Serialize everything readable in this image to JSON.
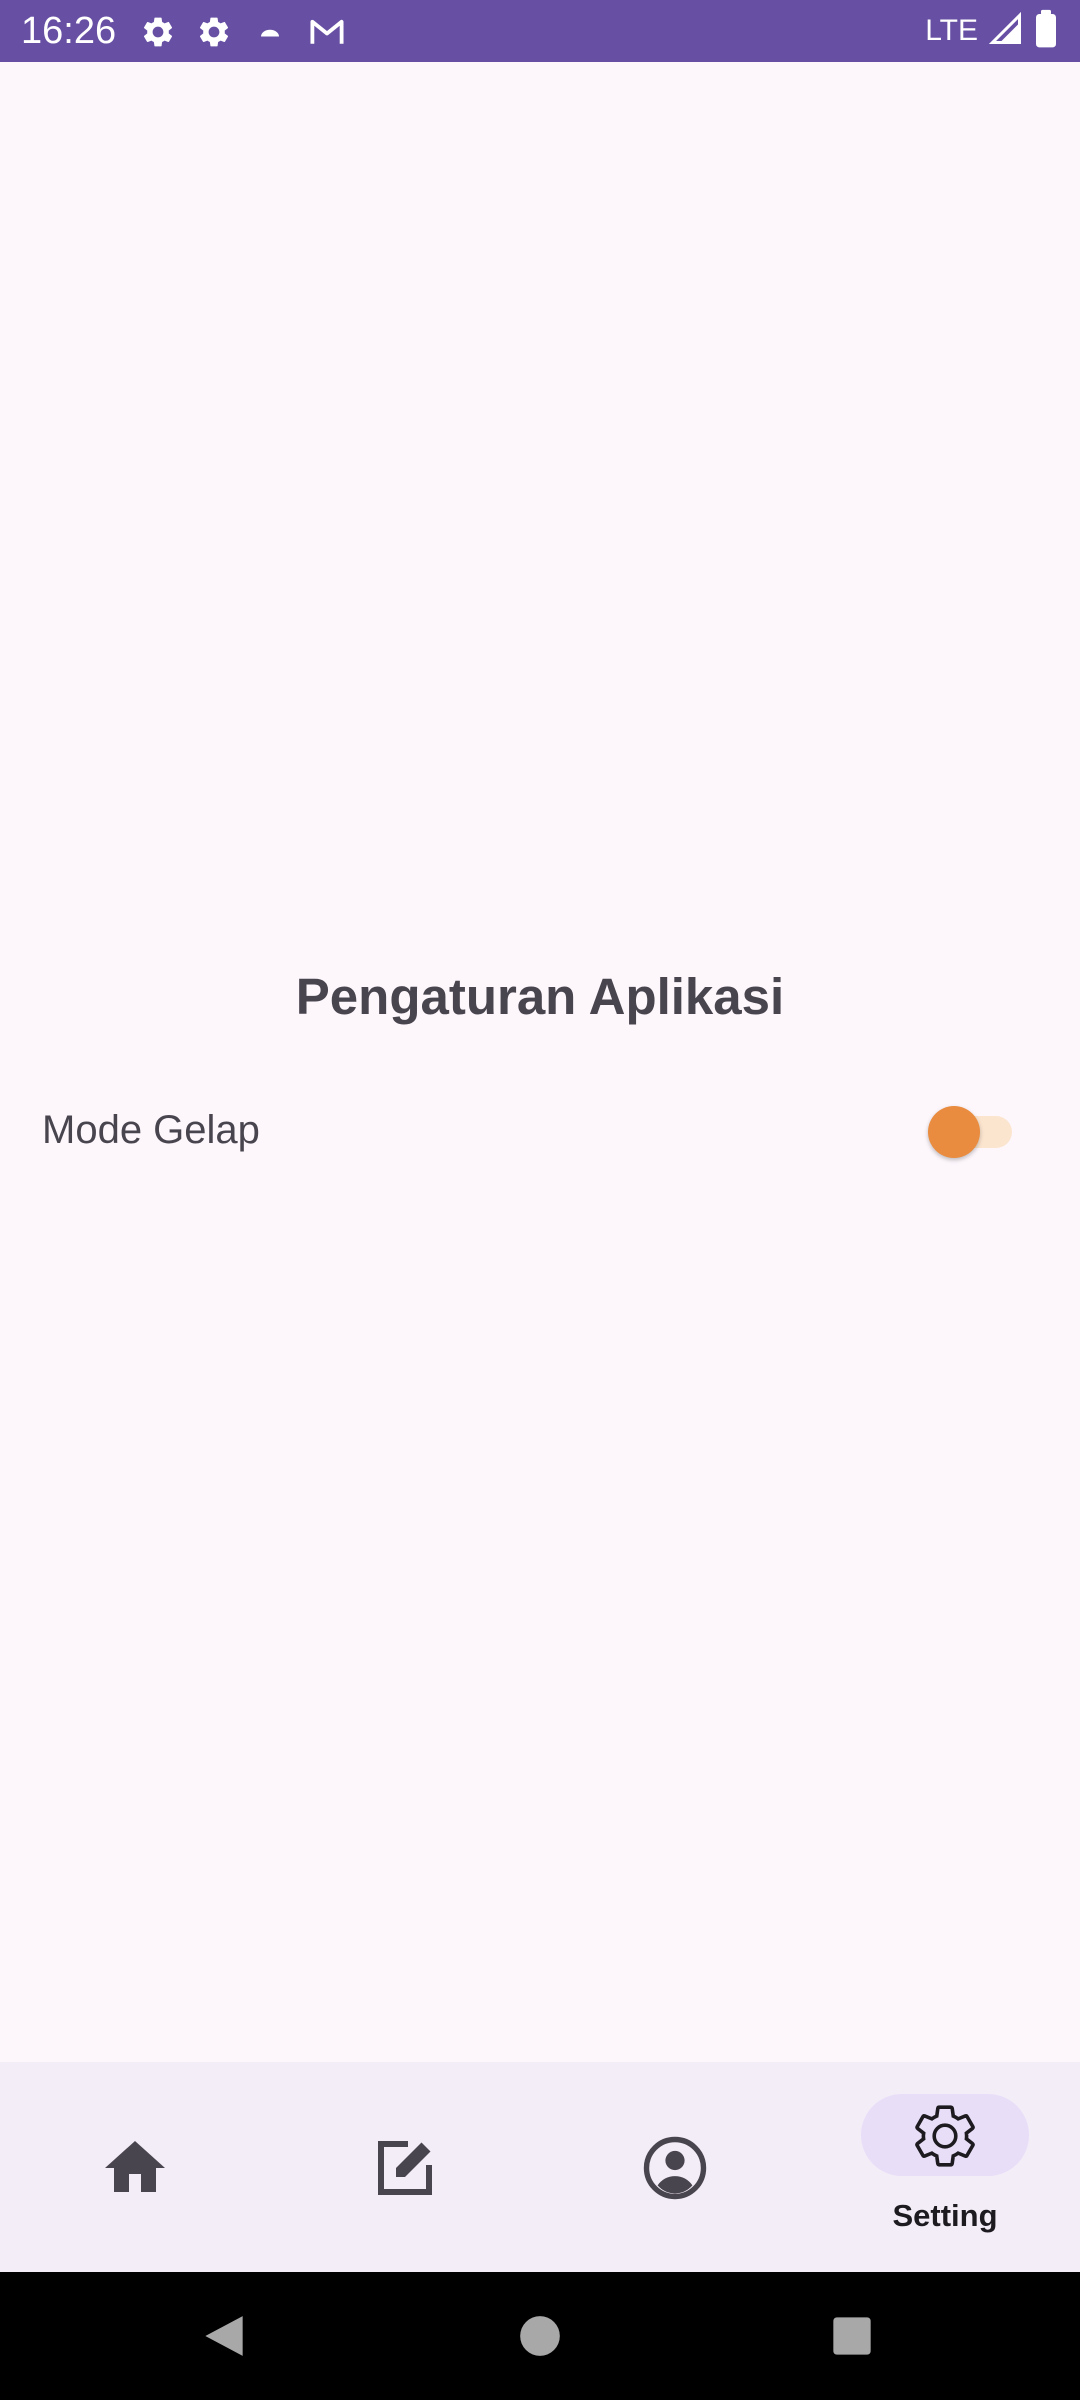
{
  "status_bar": {
    "time": "16:26",
    "network": "LTE",
    "icons": [
      "gear-icon",
      "gear-icon",
      "cloud-icon",
      "gmail-icon",
      "signal-icon",
      "battery-icon"
    ],
    "background_color": "#6750a4"
  },
  "main": {
    "title": "Pengaturan Aplikasi",
    "settings": [
      {
        "label": "Mode Gelap",
        "toggle_on": false,
        "accent_color": "#e98c3f"
      }
    ]
  },
  "bottom_nav": {
    "items": [
      {
        "icon": "home-icon",
        "label": "",
        "active": false
      },
      {
        "icon": "edit-icon",
        "label": "",
        "active": false
      },
      {
        "icon": "account-circle-icon",
        "label": "",
        "active": false
      },
      {
        "icon": "gear-icon",
        "label": "Setting",
        "active": true
      }
    ]
  },
  "system_nav": {
    "buttons": [
      "back-icon",
      "home-circle-icon",
      "recents-square-icon"
    ]
  }
}
